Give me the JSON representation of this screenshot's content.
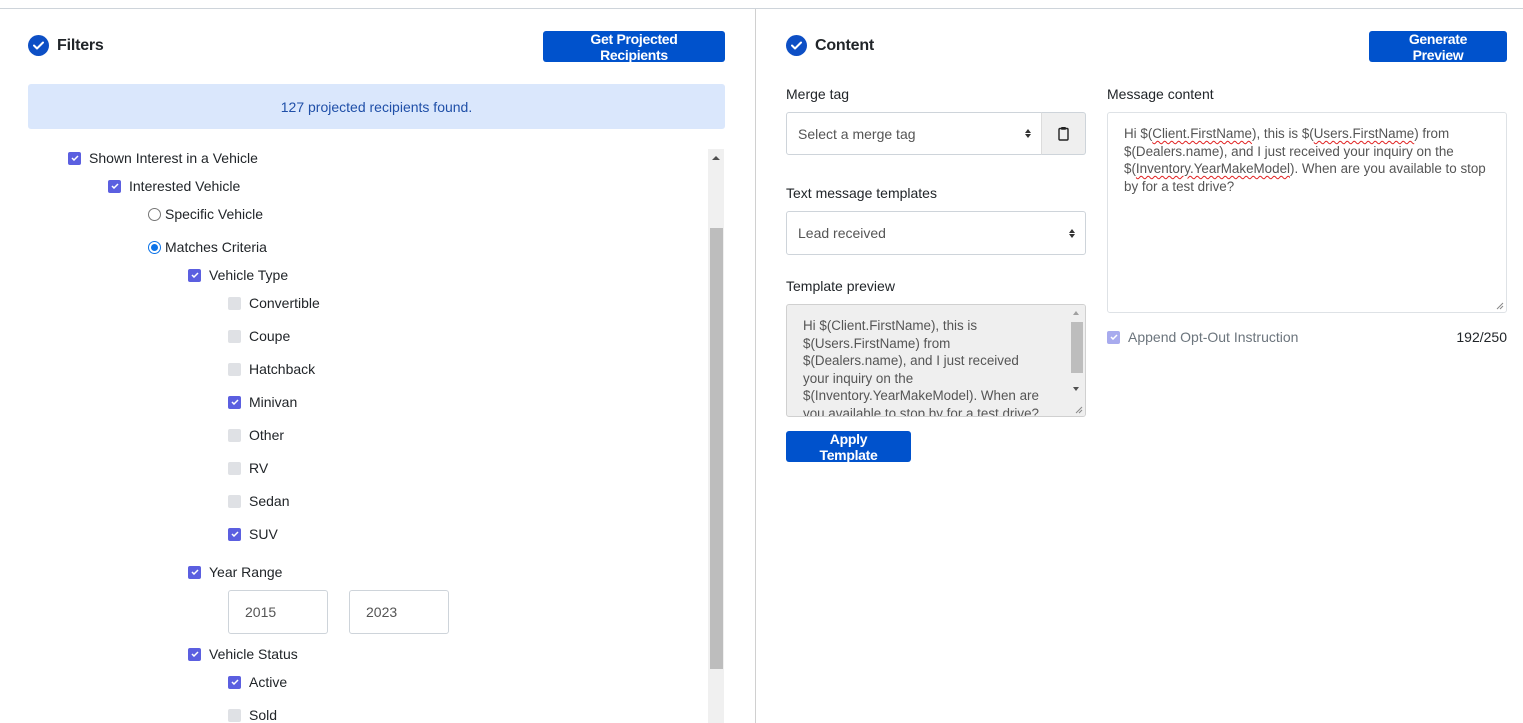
{
  "filters": {
    "title": "Filters",
    "header_icon": "circle-check-icon",
    "get_recipients_label": "Get Projected Recipients",
    "alert_text": "127 projected recipients found.",
    "tree": {
      "shown_interest": {
        "label": "Shown Interest in a Vehicle",
        "checked": true
      },
      "interested_vehicle": {
        "label": "Interested Vehicle",
        "checked": true
      },
      "specific_vehicle": {
        "label": "Specific Vehicle",
        "selected": false
      },
      "matches_criteria": {
        "label": "Matches Criteria",
        "selected": true
      },
      "vehicle_type": {
        "label": "Vehicle Type",
        "checked": true,
        "options": [
          {
            "label": "Convertible",
            "checked": false
          },
          {
            "label": "Coupe",
            "checked": false
          },
          {
            "label": "Hatchback",
            "checked": false
          },
          {
            "label": "Minivan",
            "checked": true
          },
          {
            "label": "Other",
            "checked": false
          },
          {
            "label": "RV",
            "checked": false
          },
          {
            "label": "Sedan",
            "checked": false
          },
          {
            "label": "SUV",
            "checked": true
          }
        ]
      },
      "year_range": {
        "label": "Year Range",
        "checked": true,
        "from": "2015",
        "to": "2023"
      },
      "vehicle_status": {
        "label": "Vehicle Status",
        "checked": true,
        "options": [
          {
            "label": "Active",
            "checked": true
          },
          {
            "label": "Sold",
            "checked": false
          }
        ]
      }
    }
  },
  "content": {
    "title": "Content",
    "header_icon": "circle-check-icon",
    "generate_preview_label": "Generate Preview",
    "merge_tag": {
      "label": "Merge tag",
      "placeholder": "Select a merge tag",
      "addon_icon": "clipboard-icon"
    },
    "templates": {
      "label": "Text message templates",
      "selected": "Lead received"
    },
    "template_preview": {
      "label": "Template preview",
      "lines": [
        "Hi $(Client.FirstName), this is",
        "$(Users.FirstName) from",
        "$(Dealers.name), and I just received",
        "your inquiry on the",
        "$(Inventory.YearMakeModel). When are",
        "you available to stop by for a test drive?"
      ]
    },
    "apply_template_label": "Apply Template",
    "message": {
      "label": "Message content",
      "parts": {
        "p1": "Hi $(",
        "s1": "Client.FirstName",
        "p2": "), this is $(",
        "s2": "Users.FirstName",
        "p3": ") from $(Dealers.name), and I just received your inquiry on the $(",
        "s3": "Inventory.YearMakeModel",
        "p4": "). When are you available to stop by for a test drive?"
      }
    },
    "opt_out": {
      "label": "Append Opt-Out Instruction",
      "checked": true
    },
    "char_count": "192/250"
  }
}
